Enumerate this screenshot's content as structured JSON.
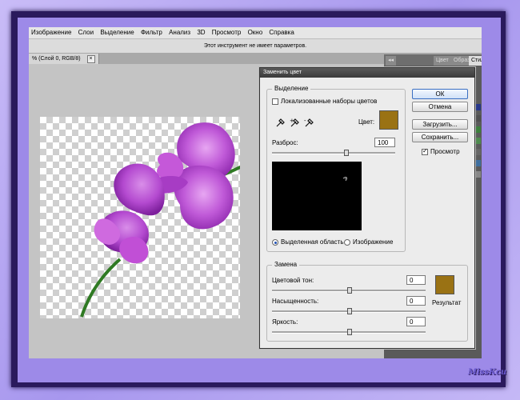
{
  "menu": [
    "Изображение",
    "Слои",
    "Выделение",
    "Фильтр",
    "Анализ",
    "3D",
    "Просмотр",
    "Окно",
    "Справка"
  ],
  "options_bar_text": "Этот инструмент не имеет параметров.",
  "document_tab": {
    "label": "% (Слой 0, RGB/8)",
    "close": "×"
  },
  "panel": {
    "collapse": "◂◂",
    "tabs": [
      "Цвет",
      "Образцы",
      "Стили"
    ]
  },
  "dialog": {
    "title": "Заменить цвет",
    "selection_group": "Выделение",
    "localized_colors_label": "Локализованные наборы цветов",
    "localized_colors_checked": false,
    "color_label": "Цвет:",
    "selection_color": "#9a7214",
    "fuzziness_label": "Разброс:",
    "fuzziness_value": "100",
    "fuzziness_level": 0.6,
    "preview_mode_selection": "Выделенная область",
    "preview_mode_image": "Изображение",
    "preview_mode": "selection",
    "replacement_group": "Замена",
    "hue_label": "Цветовой тон:",
    "hue_value": "0",
    "saturation_label": "Насыщенность:",
    "saturation_value": "0",
    "lightness_label": "Яркость:",
    "lightness_value": "0",
    "result_label": "Результат",
    "result_color": "#9a7214",
    "buttons": {
      "ok": "ОК",
      "cancel": "Отмена",
      "load": "Загрузить...",
      "save": "Сохранить..."
    },
    "preview_label": "Просмотр",
    "preview_checked": true
  },
  "watermark": "MissKcu",
  "colors": {
    "flower": "#b54bd0",
    "stem": "#2f7a23",
    "frame": "#9d8ae8"
  }
}
